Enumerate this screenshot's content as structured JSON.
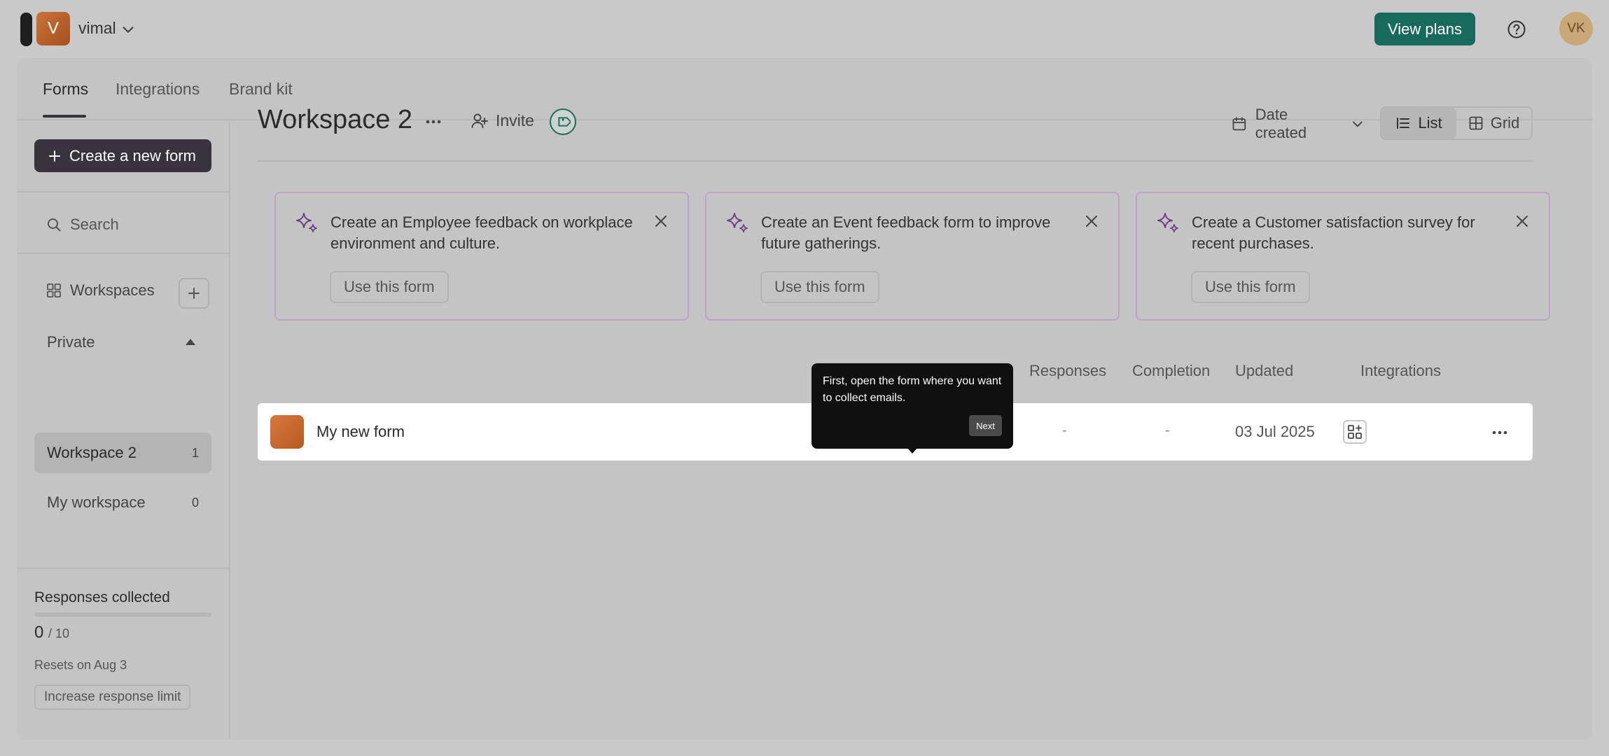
{
  "header": {
    "account_initial": "V",
    "account_name": "vimal",
    "view_plans_label": "View plans",
    "user_initials": "VK"
  },
  "tabs": [
    {
      "label": "Forms",
      "active": true
    },
    {
      "label": "Integrations",
      "active": false
    },
    {
      "label": "Brand kit",
      "active": false
    }
  ],
  "sidebar": {
    "create_label": "Create a new form",
    "search_label": "Search",
    "workspaces_label": "Workspaces",
    "private_label": "Private",
    "workspaces": [
      {
        "name": "Workspace 2",
        "count": "1",
        "active": true
      },
      {
        "name": "My workspace",
        "count": "0",
        "active": false
      }
    ],
    "responses": {
      "title": "Responses collected",
      "count": "0",
      "limit": "/ 10",
      "progress": 0,
      "reset": "Resets on Aug 3",
      "increase_label": "Increase response limit"
    }
  },
  "main": {
    "title": "Workspace 2",
    "invite_label": "Invite",
    "sort_label": "Date created",
    "view_list": "List",
    "view_grid": "Grid",
    "suggestions": [
      {
        "text": "Create an Employee feedback on workplace environment and culture.",
        "button": "Use this form"
      },
      {
        "text": "Create an Event feedback form to improve future gatherings.",
        "button": "Use this form"
      },
      {
        "text": "Create a Customer satisfaction survey for recent purchases.",
        "button": "Use this form"
      }
    ],
    "columns": {
      "responses": "Responses",
      "completion": "Completion",
      "updated": "Updated",
      "integrations": "Integrations"
    },
    "forms": [
      {
        "name": "My new form",
        "responses": "-",
        "completion": "-",
        "updated": "03 Jul 2025"
      }
    ]
  },
  "tooltip": {
    "text": "First, open the form where you want to collect emails.",
    "next_label": "Next"
  },
  "colors": {
    "accent": "#176b5d",
    "create_button": "#3a333d",
    "card_border": "#bca3c9",
    "sparkle": "#6c3f86"
  }
}
